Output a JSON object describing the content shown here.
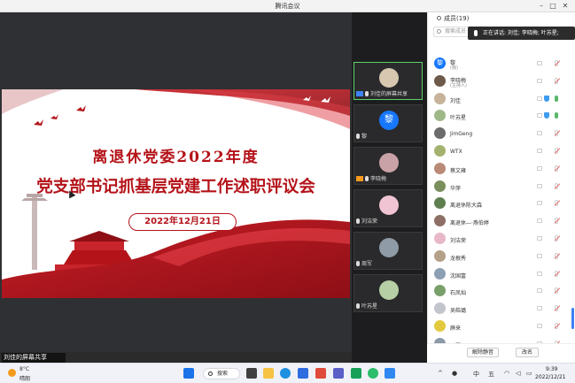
{
  "window": {
    "title": "腾讯会议"
  },
  "slide": {
    "line1": "离退休党委2022年度",
    "line2": "党支部书记抓基层党建工作述职评议会",
    "date": "2022年12月21日"
  },
  "share_status": "刘佳的屏幕共享",
  "video_tiles": [
    {
      "label": "刘佳的屏幕共享",
      "avatar_color": "#d8c7b0",
      "letter": ""
    },
    {
      "label": "黎",
      "avatar_color": "#1677ff",
      "letter": "黎"
    },
    {
      "label": "李晓梅",
      "avatar_color": "#c9a2a7",
      "letter": ""
    },
    {
      "label": "刘洁荣",
      "avatar_color": "#f0c4d2",
      "letter": ""
    },
    {
      "label": "周军",
      "avatar_color": "#8f9ba6",
      "letter": ""
    },
    {
      "label": "叶苏星",
      "avatar_color": "#b7cfa4",
      "letter": ""
    }
  ],
  "members_panel": {
    "title": "成员(19)",
    "search_placeholder": "搜索成员",
    "speaking_text": "正在讲话: 刘佳; 李晓梅; 叶苏星;",
    "members": [
      {
        "name": "黎",
        "role": "(我)",
        "color": "#1677ff",
        "letter": "黎",
        "mic": "muted"
      },
      {
        "name": "李晓梅",
        "role": "(主持人)",
        "color": "#6e5a4a",
        "letter": "",
        "mic": "muted"
      },
      {
        "name": "刘佳",
        "role": "",
        "color": "#c7b39a",
        "letter": "",
        "mic": "on"
      },
      {
        "name": "叶苏星",
        "role": "",
        "color": "#9fb888",
        "letter": "",
        "mic": "on"
      },
      {
        "name": "JimGeng",
        "role": "",
        "color": "#6b6b6b",
        "letter": "",
        "mic": "muted"
      },
      {
        "name": "WTX",
        "role": "",
        "color": "#a3b26e",
        "letter": "",
        "mic": "muted"
      },
      {
        "name": "蔡文雍",
        "role": "",
        "color": "#b98a76",
        "letter": "",
        "mic": "muted"
      },
      {
        "name": "华萍",
        "role": "",
        "color": "#7a8f5c",
        "letter": "",
        "mic": "muted"
      },
      {
        "name": "离退休陈大森",
        "role": "",
        "color": "#5f7f4f",
        "letter": "",
        "mic": "muted"
      },
      {
        "name": "离退休—·燕伯婷",
        "role": "",
        "color": "#8e6f66",
        "letter": "",
        "mic": "muted"
      },
      {
        "name": "刘洁荣",
        "role": "",
        "color": "#e8b8c8",
        "letter": "",
        "mic": "muted"
      },
      {
        "name": "龙根秀",
        "role": "",
        "color": "#b5a08a",
        "letter": "",
        "mic": "muted"
      },
      {
        "name": "沈国富",
        "role": "",
        "color": "#8c9fb4",
        "letter": "",
        "mic": "muted"
      },
      {
        "name": "石凤灿",
        "role": "",
        "color": "#79a06b",
        "letter": "",
        "mic": "muted"
      },
      {
        "name": "吴皓璐",
        "role": "",
        "color": "#c2c5cc",
        "letter": "",
        "mic": "muted"
      },
      {
        "name": "薛来",
        "role": "",
        "color": "#e2c93e",
        "letter": "",
        "mic": "muted"
      },
      {
        "name": "周军",
        "role": "",
        "color": "#8b9aa8",
        "letter": "",
        "mic": "muted"
      }
    ],
    "btn_mute_all": "解除静音",
    "btn_rename": "改名"
  },
  "taskbar": {
    "temp": "8°C",
    "weather": "晴朗",
    "search": "搜索",
    "ime_lang": "中",
    "ime_mode": "五",
    "time": "9:39",
    "date": "2022/12/21"
  }
}
